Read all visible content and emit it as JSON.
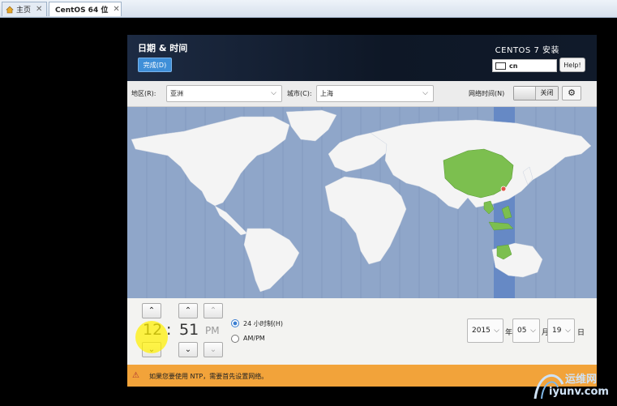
{
  "tabs": [
    {
      "label": "主页",
      "icon": "home-icon"
    },
    {
      "label": "CentOS 64 位",
      "icon": "vm-icon"
    }
  ],
  "header": {
    "title": "日期 & 时间",
    "done_label": "完成(D)",
    "product": "CENTOS 7 安装",
    "keyboard_layout": "cn",
    "help_label": "Help!"
  },
  "location": {
    "region_label": "地区(R):",
    "region_value": "亚洲",
    "city_label": "城市(C):",
    "city_value": "上海",
    "ntp_label": "网络时间(N)",
    "ntp_state": "关闭"
  },
  "time": {
    "hours": "12",
    "separator": ":",
    "minutes": "51",
    "ampm": "PM",
    "format_24h_label": "24 小时制(H)",
    "format_ampm_label": "AM/PM",
    "selected_format": "24h"
  },
  "date": {
    "year": "2015",
    "year_unit": "年",
    "month": "05",
    "month_unit": "月",
    "day": "19",
    "day_unit": "日"
  },
  "warning": {
    "text": "如果您要使用 NTP，需要首先设置网络。"
  },
  "watermark": {
    "line1": "运维网",
    "line2": "iyunv.com"
  },
  "colors": {
    "header_bg": "#111c2e",
    "accent": "#3f8fd8",
    "map_sea": "#8fa6c9",
    "map_land": "#f4f4f4",
    "map_selected": "#7cbf4f",
    "warning_bg": "#f2a33a"
  }
}
